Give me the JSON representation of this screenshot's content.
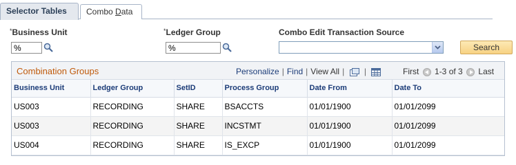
{
  "tabs": [
    {
      "label": "Selector Tables",
      "active": true
    },
    {
      "label_pre": "Combo ",
      "label_underline": "D",
      "label_post": "ata",
      "active": false
    }
  ],
  "search": {
    "business_unit": {
      "label": "Business Unit",
      "required_mark": "*",
      "value": "%"
    },
    "ledger_group": {
      "label": "Ledger Group",
      "required_mark": "*",
      "value": "%"
    },
    "combo_source": {
      "label": "Combo Edit Transaction Source",
      "value": ""
    },
    "search_button": "Search"
  },
  "grid": {
    "title": "Combination Groups",
    "nav": {
      "personalize": "Personalize",
      "find": "Find",
      "view_all": "View All"
    },
    "pager": {
      "first": "First",
      "range": "1-3 of 3",
      "last": "Last"
    },
    "columns": [
      "Business Unit",
      "Ledger Group",
      "SetID",
      "Process Group",
      "Date From",
      "Date To"
    ],
    "rows": [
      [
        "US003",
        "RECORDING",
        "SHARE",
        "BSACCTS",
        "01/01/1900",
        "01/01/2099"
      ],
      [
        "US003",
        "RECORDING",
        "SHARE",
        "INCSTMT",
        "01/01/1900",
        "01/01/2099"
      ],
      [
        "US004",
        "RECORDING",
        "SHARE",
        "IS_EXCP",
        "01/01/1900",
        "01/01/2099"
      ]
    ]
  },
  "colors": {
    "accent_title": "#c05a0b",
    "link": "#1c3c78",
    "button": "#f7d283"
  }
}
